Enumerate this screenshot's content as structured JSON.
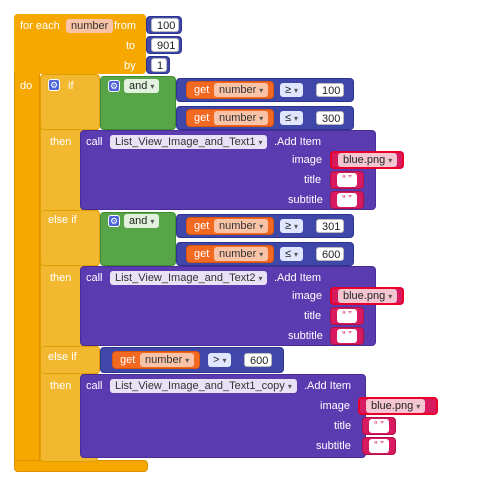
{
  "for_each": {
    "label": "for each",
    "var": "number",
    "from_label": "from",
    "from_val": "100",
    "to_label": "to",
    "to_val": "901",
    "by_label": "by",
    "by_val": "1",
    "do_label": "do"
  },
  "if_block": {
    "if_label": "if",
    "then_label": "then",
    "elseif_label": "else if",
    "and_label": "and",
    "get_label": "get",
    "var": "number",
    "op_gte": "≥",
    "op_lte": "≤",
    "op_gt": ">",
    "c1a": "100",
    "c1b": "300",
    "c2a": "301",
    "c2b": "600",
    "c3": "600"
  },
  "calls": [
    {
      "call_label": "call",
      "component": "List_View_Image_and_Text1",
      "method": ".Add Item",
      "image_label": "image",
      "image_val": "blue.png",
      "title_label": "title",
      "subtitle_label": "subtitle"
    },
    {
      "call_label": "call",
      "component": "List_View_Image_and_Text2",
      "method": ".Add Item",
      "image_label": "image",
      "image_val": "blue.png",
      "title_label": "title",
      "subtitle_label": "subtitle"
    },
    {
      "call_label": "call",
      "component": "List_View_Image_and_Text1_copy",
      "method": ".Add Item",
      "image_label": "image",
      "image_val": "blue.png",
      "title_label": "title",
      "subtitle_label": "subtitle"
    }
  ],
  "empty_text": "“ ”",
  "colors": {
    "loop": "#f6a800",
    "control": "#f2b930",
    "logic": "#58a549",
    "math": "#3f47a8",
    "variable_get": "#f26a22",
    "component_call": "#5b3bb0",
    "text": "#d81b60"
  }
}
